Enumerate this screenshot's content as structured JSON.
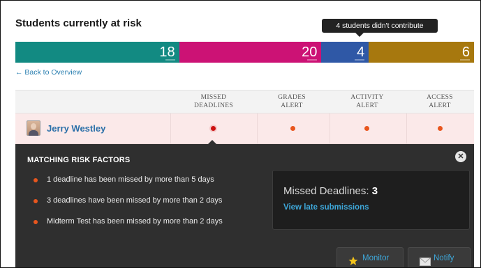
{
  "title": "Students currently at risk",
  "tooltip": "4 students didn't contribute",
  "risk_bar": [
    {
      "value": "18",
      "color": "#128a82",
      "share": 0.357
    },
    {
      "value": "20",
      "color": "#cc1275",
      "share": 0.31
    },
    {
      "value": "4",
      "color": "#2f58a6",
      "share": 0.103
    },
    {
      "value": "6",
      "color": "#a7780e",
      "share": 0.23
    }
  ],
  "back_link": "← Back to Overview",
  "columns": [
    {
      "line1": "MISSED",
      "line2": "DEADLINES"
    },
    {
      "line1": "GRADES",
      "line2": "ALERT"
    },
    {
      "line1": "ACTIVITY",
      "line2": "ALERT"
    },
    {
      "line1": "ACCESS",
      "line2": "ALERT"
    }
  ],
  "student": {
    "name": "Jerry Westley"
  },
  "panel": {
    "title": "MATCHING RISK FACTORS",
    "close_icon": "close-icon",
    "factors": [
      "1 deadline has been missed by more than 5 days",
      "3 deadlines have been missed by more than 2 days",
      "Midterm Test has been missed by more than 2 days"
    ],
    "summary_label": "Missed Deadlines:",
    "summary_count": "3",
    "summary_link": "View late submissions",
    "monitor_label": "Monitor",
    "notify_label": "Notify"
  }
}
